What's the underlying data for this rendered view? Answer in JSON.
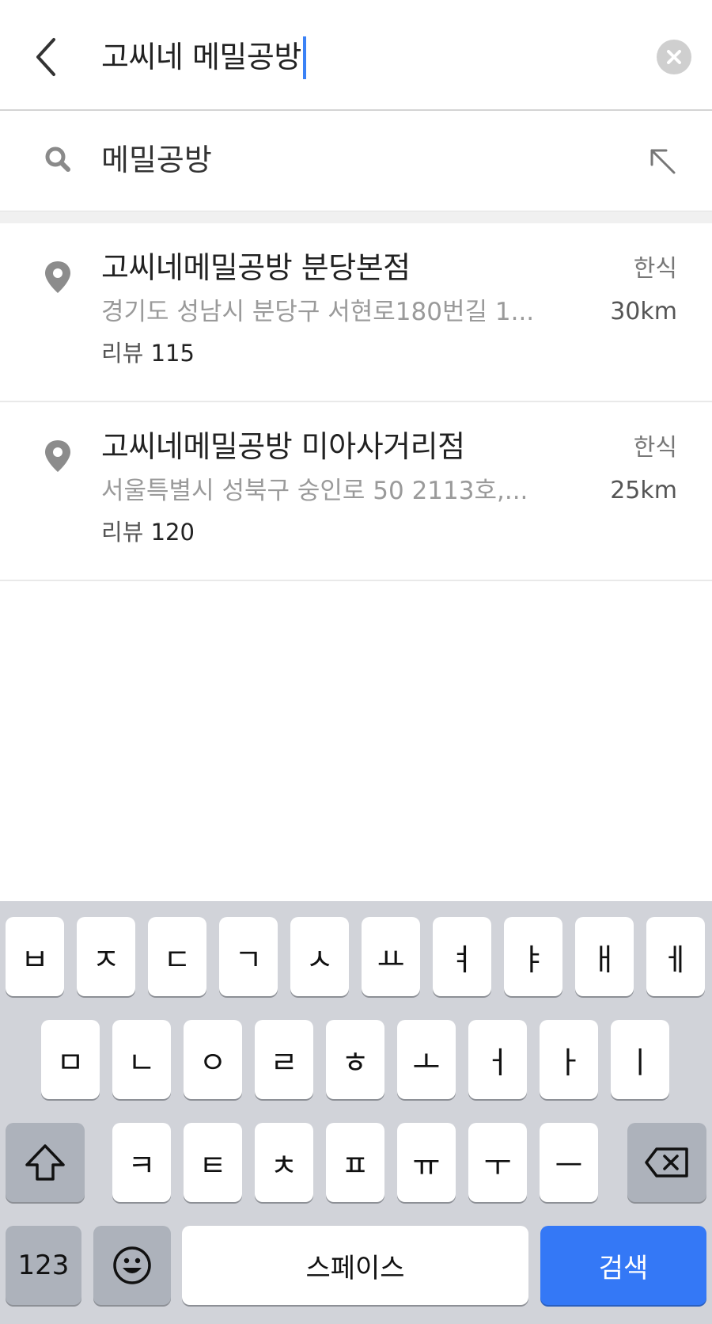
{
  "header": {
    "query": "고씨네 메밀공방",
    "back_icon": "chevron-left-icon",
    "clear_icon": "clear-x-icon"
  },
  "suggestion": {
    "text": "메밀공방",
    "icon": "search-icon",
    "insert_icon": "arrow-up-left-icon"
  },
  "results": [
    {
      "name": "고씨네메밀공방 분당본점",
      "address": "경기도 성남시 분당구 서현로180번길 1...",
      "review_label": "리뷰",
      "review_count": "115",
      "category": "한식",
      "distance": "30km"
    },
    {
      "name": "고씨네메밀공방 미아사거리점",
      "address": "서울특별시 성북구 숭인로 50 2113호,...",
      "review_label": "리뷰",
      "review_count": "120",
      "category": "한식",
      "distance": "25km"
    }
  ],
  "keyboard": {
    "row1": [
      "ㅂ",
      "ㅈ",
      "ㄷ",
      "ㄱ",
      "ㅅ",
      "ㅛ",
      "ㅕ",
      "ㅑ",
      "ㅐ",
      "ㅔ"
    ],
    "row2": [
      "ㅁ",
      "ㄴ",
      "ㅇ",
      "ㄹ",
      "ㅎ",
      "ㅗ",
      "ㅓ",
      "ㅏ",
      "ㅣ"
    ],
    "row3": [
      "ㅋ",
      "ㅌ",
      "ㅊ",
      "ㅍ",
      "ㅠ",
      "ㅜ",
      "ㅡ"
    ],
    "numbers_label": "123",
    "space_label": "스페이스",
    "search_label": "검색",
    "shift_icon": "shift-icon",
    "backspace_icon": "backspace-icon",
    "emoji_icon": "emoji-icon"
  },
  "colors": {
    "accent": "#3478f6",
    "caret": "#3b82f6"
  }
}
